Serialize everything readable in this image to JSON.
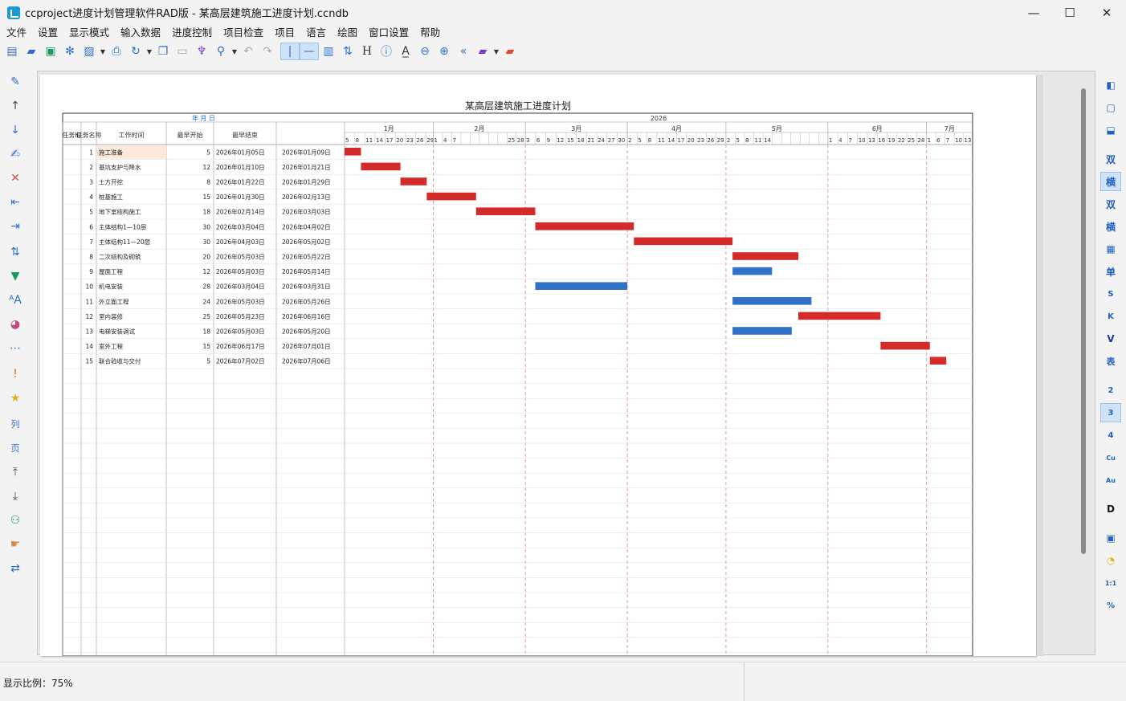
{
  "window": {
    "title": "ccproject进度计划管理软件RAD版 - 某高层建筑施工进度计划.ccndb",
    "minimize": "—",
    "maximize": "☐",
    "close": "✕"
  },
  "menu": [
    "文件",
    "设置",
    "显示模式",
    "输入数据",
    "进度控制",
    "项目检查",
    "项目",
    "语言",
    "绘图",
    "窗口设置",
    "帮助"
  ],
  "right_toolbar": {
    "labels": [
      "双",
      "横",
      "双",
      "横",
      "单",
      "S",
      "K",
      "V",
      "表",
      "2",
      "3",
      "4",
      "Cu",
      "Au",
      "D",
      "1:1",
      "%"
    ]
  },
  "left_toolbar": {
    "labels": [
      "列",
      "页"
    ]
  },
  "chart": {
    "title": "某高层建筑施工进度计划",
    "date_header": "年 月 日",
    "year": "2026",
    "columns": [
      "任务ID",
      "任务名称",
      "工作时间",
      "最早开始",
      "最早结束"
    ],
    "months": [
      "1月",
      "2月",
      "3月",
      "4月",
      "5月",
      "6月",
      "7月"
    ],
    "day_ticks": [
      [
        "5",
        "8",
        "11",
        "14",
        "17",
        "20",
        "23",
        "26",
        "29"
      ],
      [
        "1",
        "4",
        "7",
        "",
        "",
        "",
        "",
        "",
        "25",
        "28"
      ],
      [
        "3",
        "6",
        "9",
        "12",
        "15",
        "18",
        "21",
        "24",
        "27",
        "30"
      ],
      [
        "2",
        "5",
        "8",
        "11",
        "14",
        "17",
        "20",
        "23",
        "26",
        "29"
      ],
      [
        "2",
        "5",
        "8",
        "11",
        "14",
        "",
        "",
        "",
        "",
        "",
        ""
      ],
      [
        "1",
        "4",
        "7",
        "10",
        "13",
        "16",
        "19",
        "22",
        "25",
        "28"
      ],
      [
        "1",
        "6",
        "7",
        "10",
        "13"
      ]
    ],
    "colors": {
      "critical": "#d42a2a",
      "noncritical": "#2f72c8",
      "grid": "#c8c8c8",
      "monthline": "#d08a8a"
    }
  },
  "chart_data": {
    "type": "table",
    "tasks": [
      {
        "id": "1",
        "name": "施工准备",
        "duration": "5",
        "start": "2026年01月05日",
        "finish": "2026年01月09日",
        "critical": true
      },
      {
        "id": "2",
        "name": "基坑支护与降水",
        "duration": "12",
        "start": "2026年01月10日",
        "finish": "2026年01月21日",
        "critical": true
      },
      {
        "id": "3",
        "name": "土方开挖",
        "duration": "8",
        "start": "2026年01月22日",
        "finish": "2026年01月29日",
        "critical": true
      },
      {
        "id": "4",
        "name": "桩基施工",
        "duration": "15",
        "start": "2026年01月30日",
        "finish": "2026年02月13日",
        "critical": true
      },
      {
        "id": "5",
        "name": "地下室结构施工",
        "duration": "18",
        "start": "2026年02月14日",
        "finish": "2026年03月03日",
        "critical": true
      },
      {
        "id": "6",
        "name": "主体结构1—10层",
        "duration": "30",
        "start": "2026年03月04日",
        "finish": "2026年04月02日",
        "critical": true
      },
      {
        "id": "7",
        "name": "主体结构11—20层",
        "duration": "30",
        "start": "2026年04月03日",
        "finish": "2026年05月02日",
        "critical": true
      },
      {
        "id": "8",
        "name": "二次结构及砌筑",
        "duration": "20",
        "start": "2026年05月03日",
        "finish": "2026年05月22日",
        "critical": true
      },
      {
        "id": "9",
        "name": "屋面工程",
        "duration": "12",
        "start": "2026年05月03日",
        "finish": "2026年05月14日",
        "critical": false
      },
      {
        "id": "10",
        "name": "机电安装",
        "duration": "28",
        "start": "2026年03月04日",
        "finish": "2026年03月31日",
        "critical": false
      },
      {
        "id": "11",
        "name": "外立面工程",
        "duration": "24",
        "start": "2026年05月03日",
        "finish": "2026年05月26日",
        "critical": false
      },
      {
        "id": "12",
        "name": "室内装修",
        "duration": "25",
        "start": "2026年05月23日",
        "finish": "2026年06月16日",
        "critical": true
      },
      {
        "id": "13",
        "name": "电梯安装调试",
        "duration": "18",
        "start": "2026年05月03日",
        "finish": "2026年05月20日",
        "critical": false
      },
      {
        "id": "14",
        "name": "室外工程",
        "duration": "15",
        "start": "2026年06月17日",
        "finish": "2026年07月01日",
        "critical": true
      },
      {
        "id": "15",
        "name": "联合验收与交付",
        "duration": "5",
        "start": "2026年07月02日",
        "finish": "2026年07月06日",
        "critical": true
      }
    ]
  },
  "status": {
    "zoom_text": "显示比例：75%"
  }
}
